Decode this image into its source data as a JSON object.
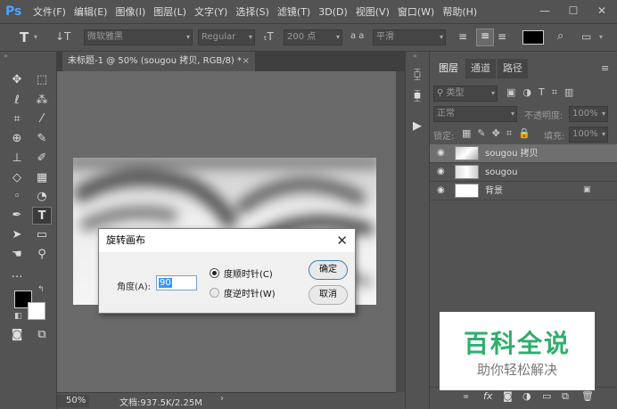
{
  "app": {
    "logo": "Ps"
  },
  "menu": [
    "文件(F)",
    "编辑(E)",
    "图像(I)",
    "图层(L)",
    "文字(Y)",
    "选择(S)",
    "滤镜(T)",
    "3D(D)",
    "视图(V)",
    "窗口(W)",
    "帮助(H)"
  ],
  "window_buttons": [
    "—",
    "☐",
    "✕"
  ],
  "options": {
    "font_family": "微软雅黑",
    "font_style": "Regular",
    "font_size": "200 点",
    "aa_label": "a a",
    "aa_value": "平滑",
    "color": "#000000"
  },
  "doc": {
    "tab": "未标题-1 @ 50% (sougou 拷贝, RGB/8) *",
    "zoom": "50%",
    "docsize": "文档:937.5K/2.25M"
  },
  "panel": {
    "tabs": [
      "图层",
      "通道",
      "路径"
    ],
    "filter": "类型",
    "blend": "正常",
    "opacity_label": "不透明度:",
    "opacity": "100%",
    "lock_label": "锁定:",
    "fill_label": "填充:",
    "fill": "100%"
  },
  "layers": [
    {
      "name": "sougou 拷贝",
      "selected": true
    },
    {
      "name": "sougou",
      "selected": false
    },
    {
      "name": "背景",
      "selected": false,
      "locked": true
    }
  ],
  "dialog": {
    "title": "旋转画布",
    "angle_label": "角度(A):",
    "angle_value": "90",
    "cw": "度顺时针(C)",
    "ccw": "度逆时针(W)",
    "ok": "确定",
    "cancel": "取消"
  },
  "watermark": {
    "title": "百科全说",
    "subtitle": "助你轻松解决"
  }
}
